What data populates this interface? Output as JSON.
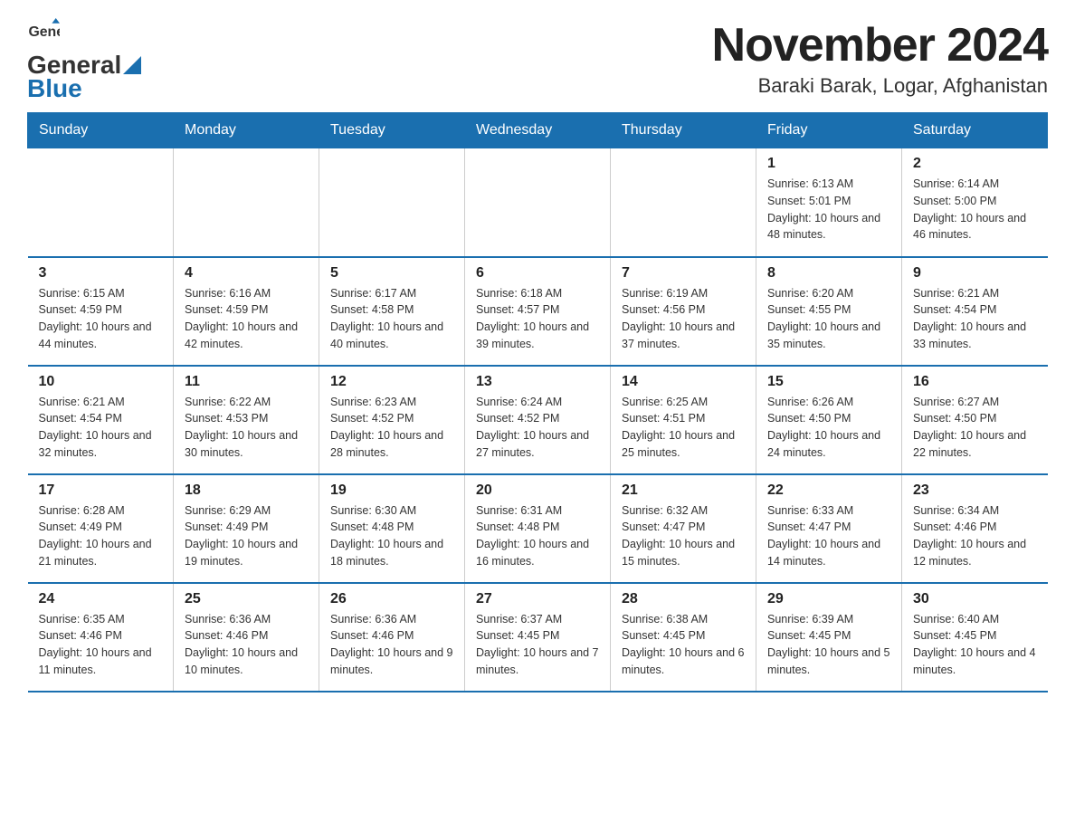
{
  "header": {
    "logo_top": "General",
    "logo_bottom": "Blue",
    "month_title": "November 2024",
    "location": "Baraki Barak, Logar, Afghanistan"
  },
  "days_of_week": [
    "Sunday",
    "Monday",
    "Tuesday",
    "Wednesday",
    "Thursday",
    "Friday",
    "Saturday"
  ],
  "weeks": [
    [
      {
        "day": "",
        "info": ""
      },
      {
        "day": "",
        "info": ""
      },
      {
        "day": "",
        "info": ""
      },
      {
        "day": "",
        "info": ""
      },
      {
        "day": "",
        "info": ""
      },
      {
        "day": "1",
        "info": "Sunrise: 6:13 AM\nSunset: 5:01 PM\nDaylight: 10 hours and 48 minutes."
      },
      {
        "day": "2",
        "info": "Sunrise: 6:14 AM\nSunset: 5:00 PM\nDaylight: 10 hours and 46 minutes."
      }
    ],
    [
      {
        "day": "3",
        "info": "Sunrise: 6:15 AM\nSunset: 4:59 PM\nDaylight: 10 hours and 44 minutes."
      },
      {
        "day": "4",
        "info": "Sunrise: 6:16 AM\nSunset: 4:59 PM\nDaylight: 10 hours and 42 minutes."
      },
      {
        "day": "5",
        "info": "Sunrise: 6:17 AM\nSunset: 4:58 PM\nDaylight: 10 hours and 40 minutes."
      },
      {
        "day": "6",
        "info": "Sunrise: 6:18 AM\nSunset: 4:57 PM\nDaylight: 10 hours and 39 minutes."
      },
      {
        "day": "7",
        "info": "Sunrise: 6:19 AM\nSunset: 4:56 PM\nDaylight: 10 hours and 37 minutes."
      },
      {
        "day": "8",
        "info": "Sunrise: 6:20 AM\nSunset: 4:55 PM\nDaylight: 10 hours and 35 minutes."
      },
      {
        "day": "9",
        "info": "Sunrise: 6:21 AM\nSunset: 4:54 PM\nDaylight: 10 hours and 33 minutes."
      }
    ],
    [
      {
        "day": "10",
        "info": "Sunrise: 6:21 AM\nSunset: 4:54 PM\nDaylight: 10 hours and 32 minutes."
      },
      {
        "day": "11",
        "info": "Sunrise: 6:22 AM\nSunset: 4:53 PM\nDaylight: 10 hours and 30 minutes."
      },
      {
        "day": "12",
        "info": "Sunrise: 6:23 AM\nSunset: 4:52 PM\nDaylight: 10 hours and 28 minutes."
      },
      {
        "day": "13",
        "info": "Sunrise: 6:24 AM\nSunset: 4:52 PM\nDaylight: 10 hours and 27 minutes."
      },
      {
        "day": "14",
        "info": "Sunrise: 6:25 AM\nSunset: 4:51 PM\nDaylight: 10 hours and 25 minutes."
      },
      {
        "day": "15",
        "info": "Sunrise: 6:26 AM\nSunset: 4:50 PM\nDaylight: 10 hours and 24 minutes."
      },
      {
        "day": "16",
        "info": "Sunrise: 6:27 AM\nSunset: 4:50 PM\nDaylight: 10 hours and 22 minutes."
      }
    ],
    [
      {
        "day": "17",
        "info": "Sunrise: 6:28 AM\nSunset: 4:49 PM\nDaylight: 10 hours and 21 minutes."
      },
      {
        "day": "18",
        "info": "Sunrise: 6:29 AM\nSunset: 4:49 PM\nDaylight: 10 hours and 19 minutes."
      },
      {
        "day": "19",
        "info": "Sunrise: 6:30 AM\nSunset: 4:48 PM\nDaylight: 10 hours and 18 minutes."
      },
      {
        "day": "20",
        "info": "Sunrise: 6:31 AM\nSunset: 4:48 PM\nDaylight: 10 hours and 16 minutes."
      },
      {
        "day": "21",
        "info": "Sunrise: 6:32 AM\nSunset: 4:47 PM\nDaylight: 10 hours and 15 minutes."
      },
      {
        "day": "22",
        "info": "Sunrise: 6:33 AM\nSunset: 4:47 PM\nDaylight: 10 hours and 14 minutes."
      },
      {
        "day": "23",
        "info": "Sunrise: 6:34 AM\nSunset: 4:46 PM\nDaylight: 10 hours and 12 minutes."
      }
    ],
    [
      {
        "day": "24",
        "info": "Sunrise: 6:35 AM\nSunset: 4:46 PM\nDaylight: 10 hours and 11 minutes."
      },
      {
        "day": "25",
        "info": "Sunrise: 6:36 AM\nSunset: 4:46 PM\nDaylight: 10 hours and 10 minutes."
      },
      {
        "day": "26",
        "info": "Sunrise: 6:36 AM\nSunset: 4:46 PM\nDaylight: 10 hours and 9 minutes."
      },
      {
        "day": "27",
        "info": "Sunrise: 6:37 AM\nSunset: 4:45 PM\nDaylight: 10 hours and 7 minutes."
      },
      {
        "day": "28",
        "info": "Sunrise: 6:38 AM\nSunset: 4:45 PM\nDaylight: 10 hours and 6 minutes."
      },
      {
        "day": "29",
        "info": "Sunrise: 6:39 AM\nSunset: 4:45 PM\nDaylight: 10 hours and 5 minutes."
      },
      {
        "day": "30",
        "info": "Sunrise: 6:40 AM\nSunset: 4:45 PM\nDaylight: 10 hours and 4 minutes."
      }
    ]
  ]
}
